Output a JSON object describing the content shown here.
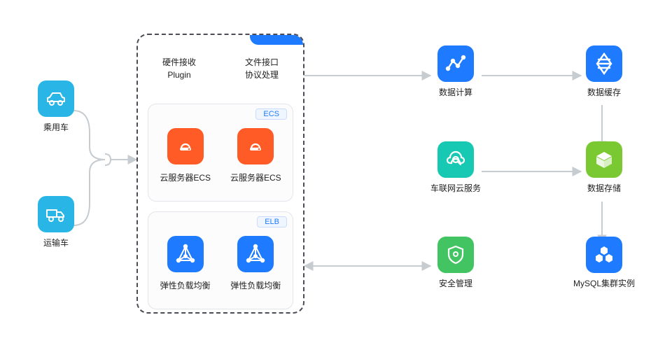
{
  "left": {
    "car": {
      "label": "乘用车"
    },
    "truck": {
      "label": "运输车"
    }
  },
  "center": {
    "top1_line1": "硬件接收",
    "top1_line2": "Plugin",
    "top2_line1": "文件接口",
    "top2_line2": "协议处理",
    "ecs": {
      "badge": "ECS",
      "item1": "云服务器ECS",
      "item2": "云服务器ECS"
    },
    "elb": {
      "badge": "ELB",
      "item1": "弹性负载均衡",
      "item2": "弹性负载均衡"
    }
  },
  "right": {
    "analytics": {
      "label": "数据计算"
    },
    "stream": {
      "label": "数据缓存"
    },
    "cloudsearch": {
      "label": "车联网云服务"
    },
    "cube": {
      "label": "数据存储"
    },
    "shield": {
      "label": "安全管理"
    },
    "honeycomb": {
      "label": "MySQL集群实例"
    }
  }
}
